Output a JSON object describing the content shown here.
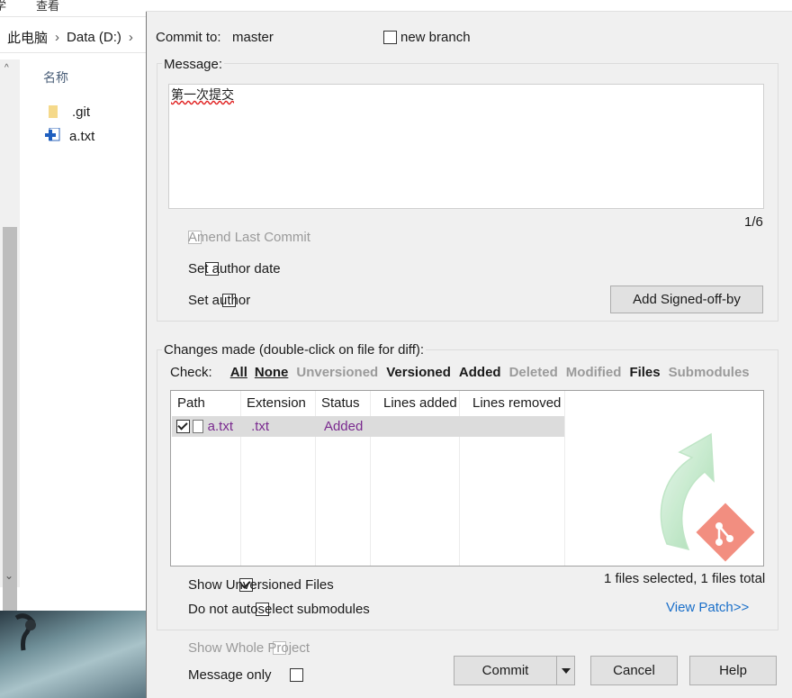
{
  "explorer": {
    "top_partial_left": "学",
    "top_partial_right": "查看",
    "breadcrumb": [
      "此电脑",
      "Data (D:)"
    ],
    "column_header": "名称",
    "files": [
      {
        "name": ".git",
        "icon": "folder-icon"
      },
      {
        "name": "a.txt",
        "icon": "text-file-added-icon"
      }
    ]
  },
  "dialog": {
    "commit_to_label": "Commit to:",
    "branch": "master",
    "new_branch_label": "new branch",
    "message_label": "Message:",
    "message_text": "第一次提交",
    "message_counter": "1/6",
    "amend_label": "Amend Last Commit",
    "set_author_date_label": "Set author date",
    "set_author_label": "Set author",
    "signed_off_button": "Add Signed-off-by",
    "changes_label": "Changes made (double-click on file for diff):",
    "check_label": "Check:",
    "filters": [
      {
        "label": "All",
        "state": "link"
      },
      {
        "label": "None",
        "state": "link"
      },
      {
        "label": "Unversioned",
        "state": "disabled"
      },
      {
        "label": "Versioned",
        "state": "active"
      },
      {
        "label": "Added",
        "state": "active"
      },
      {
        "label": "Deleted",
        "state": "disabled"
      },
      {
        "label": "Modified",
        "state": "disabled"
      },
      {
        "label": "Files",
        "state": "active"
      },
      {
        "label": "Submodules",
        "state": "disabled"
      }
    ],
    "columns": [
      "Path",
      "Extension",
      "Status",
      "Lines added",
      "Lines removed"
    ],
    "rows": [
      {
        "path": "a.txt",
        "extension": ".txt",
        "status": "Added",
        "lines_added": "",
        "lines_removed": "",
        "checked": true
      }
    ],
    "show_unversioned_label": "Show Unversioned Files",
    "no_autoselect_label": "Do not autoselect submodules",
    "files_summary": "1 files selected, 1 files total",
    "view_patch_label": "View Patch>>",
    "show_whole_project_label": "Show Whole Project",
    "message_only_label": "Message only",
    "commit_button": "Commit",
    "cancel_button": "Cancel",
    "help_button": "Help",
    "colors": {
      "added": "#7a2a8f",
      "link": "#1a6fc9",
      "selected_row": "#dcdcdc"
    }
  }
}
